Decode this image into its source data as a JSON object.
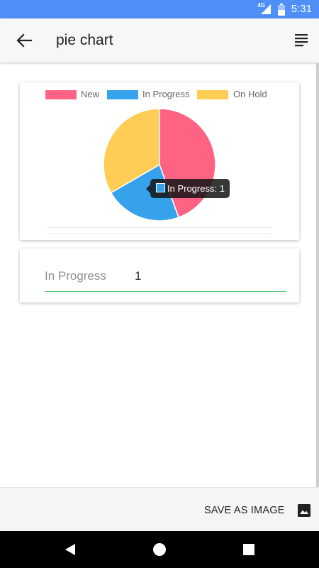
{
  "status_bar": {
    "time": "5:31",
    "network": "4G",
    "background_color": "#4f8ff7",
    "icons": [
      "signal-icon",
      "battery-icon"
    ]
  },
  "app_bar": {
    "title": "pie chart",
    "back_icon": "arrow-left-icon",
    "menu_icon": "sort-lines-icon"
  },
  "chart_data": {
    "type": "pie",
    "categories": [
      "New",
      "In Progress",
      "On Hold"
    ],
    "values": [
      2,
      1,
      1.5
    ],
    "colors": [
      "#ff6384",
      "#36a2eb",
      "#ffcd56"
    ],
    "legend_position": "top",
    "tooltip": {
      "label": "In Progress: 1",
      "color": "#36a2eb"
    }
  },
  "selected_value": {
    "label": "In Progress",
    "value": "1",
    "underline_color": "#4cc36f"
  },
  "bottom_bar": {
    "save_label": "SAVE AS IMAGE",
    "save_icon": "image-icon"
  },
  "nav_bar": {
    "icons": [
      "back-triangle-icon",
      "home-circle-icon",
      "recents-square-icon"
    ]
  }
}
